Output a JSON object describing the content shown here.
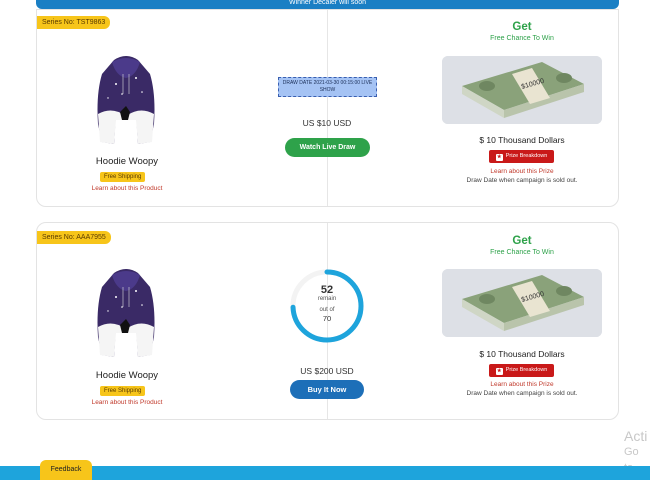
{
  "banner": "Winner Decaler will soon",
  "campaigns": [
    {
      "series": "Series No: TST9863",
      "product_name": "Hoodie Woopy",
      "shipping": "Free Shipping",
      "learn_product": "Learn about this Product",
      "draw_date": "DRAW DATE 2021-03-30 00:15:00 LIVE SHOW",
      "price": "US $10 USD",
      "action": "Watch Live Draw",
      "get": "Get",
      "get_sub": "Free Chance To Win",
      "prize": "$ 10 Thousand Dollars",
      "prize_button": "Prize Breakdown",
      "learn_prize": "Learn about this Prize",
      "draw_note": "Draw Date when campaign is sold out."
    },
    {
      "series": "Series No: AAA7955",
      "product_name": "Hoodie Woopy",
      "shipping": "Free Shipping",
      "learn_product": "Learn about this Product",
      "remaining": "52",
      "remain_label": "remain",
      "out_of_label": "out of",
      "total": "70",
      "remaining_fraction": 0.743,
      "price": "US $200 USD",
      "action": "Buy It Now",
      "get": "Get",
      "get_sub": "Free Chance To Win",
      "prize": "$ 10 Thousand Dollars",
      "prize_button": "Prize Breakdown",
      "learn_prize": "Learn about this Prize",
      "draw_note": "Draw Date when campaign is sold out."
    }
  ],
  "feedback": "Feedback",
  "watermark": {
    "line1": "Acti",
    "line2": "Go to"
  },
  "colors": {
    "accent_blue": "#1d6fb8",
    "green": "#2ea24a",
    "tag_yellow": "#f7c51a",
    "prize_red": "#c91919"
  }
}
